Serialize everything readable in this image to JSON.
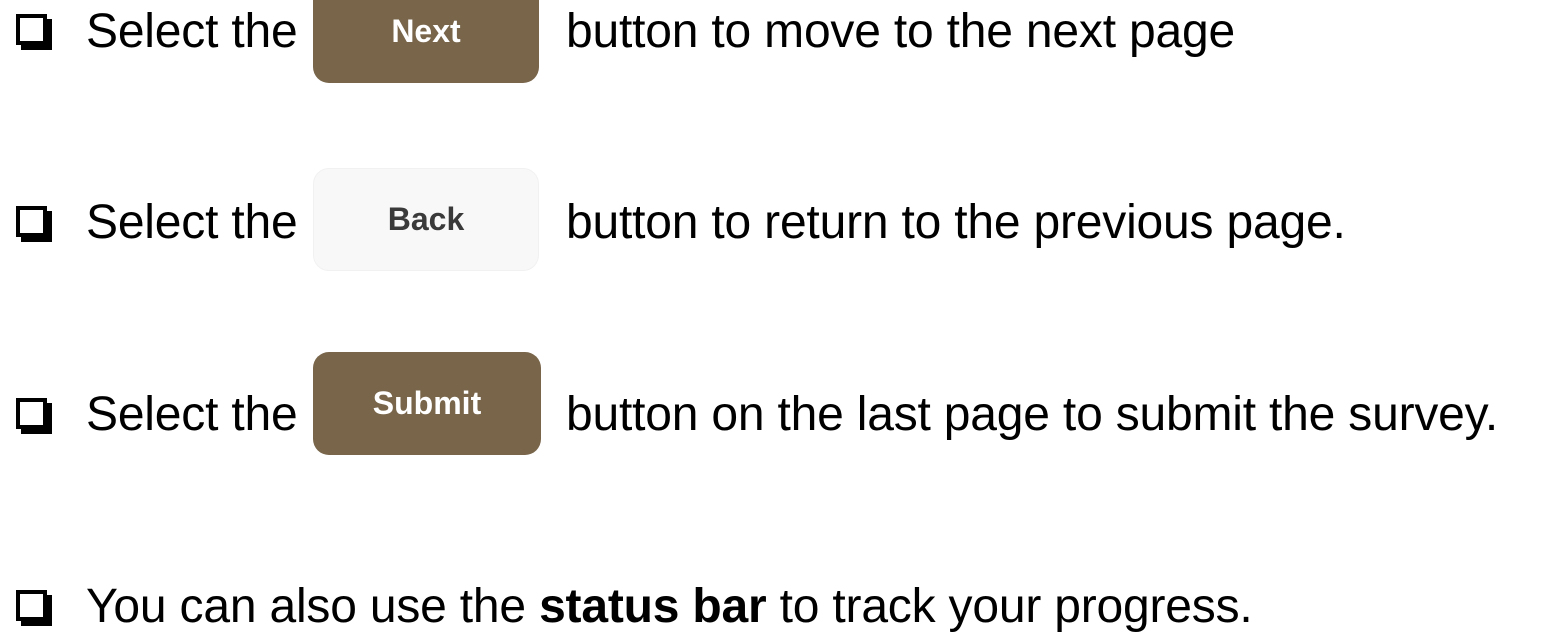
{
  "colors": {
    "primary_button_bg": "#78654a",
    "primary_button_text": "#ffffff",
    "secondary_button_bg": "#f8f8f8",
    "secondary_button_text": "#3a3a3a",
    "text": "#000000"
  },
  "icons": {
    "bullet": "checkbox-icon"
  },
  "instructions": [
    {
      "prefix": "Select the",
      "button_label": "Next",
      "suffix": "button to move to the next page"
    },
    {
      "prefix": "Select the",
      "button_label": "Back",
      "suffix": "button to return to the previous page."
    },
    {
      "prefix": "Select the",
      "button_label": "Submit",
      "suffix": "button on the last page to submit the survey."
    }
  ],
  "status_note": {
    "before": "You can also use the",
    "bold": "status bar",
    "after": "to track your progress."
  }
}
